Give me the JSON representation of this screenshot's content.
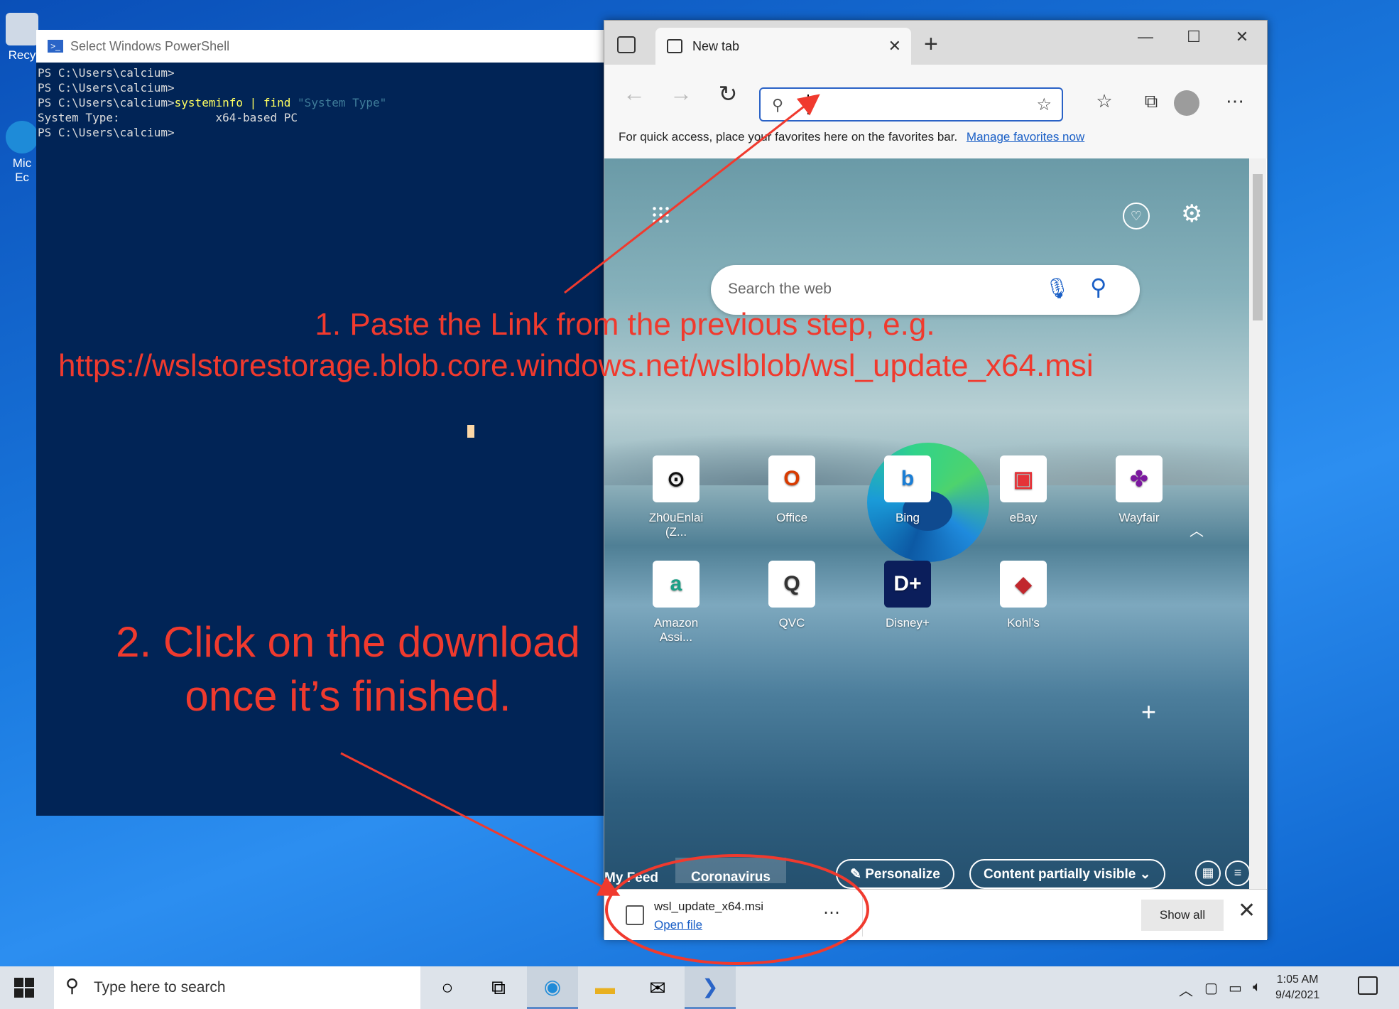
{
  "desktop": {
    "icons": [
      {
        "label": "Recy",
        "icon": "recycle-bin-icon"
      },
      {
        "label": "Mic Ec",
        "icon": "edge-shortcut-icon"
      }
    ]
  },
  "powershell": {
    "title": "Select Windows PowerShell",
    "lines": [
      {
        "prompt": "PS C:\\Users\\calcium>",
        "cmd": "",
        "arg": "",
        "str": ""
      },
      {
        "prompt": "PS C:\\Users\\calcium>",
        "cmd": "",
        "arg": "",
        "str": ""
      },
      {
        "prompt": "PS C:\\Users\\calcium>",
        "cmd": "systeminfo",
        "arg": " | find ",
        "str": "\"System Type\""
      },
      {
        "prompt": "System Type:              x64-based PC",
        "cmd": "",
        "arg": "",
        "str": ""
      },
      {
        "prompt": "PS C:\\Users\\calcium>",
        "cmd": "",
        "arg": "",
        "str": ""
      }
    ]
  },
  "edge": {
    "tab_title": "New tab",
    "favbar_text": "For quick access, place your favorites here on the favorites bar.",
    "favbar_link": "Manage favorites now",
    "ntp_search_placeholder": "Search the web",
    "tiles": [
      {
        "label": "Zh0uEnlai (Z...",
        "icon": "github-icon",
        "glyph": "⊙",
        "color": "#111"
      },
      {
        "label": "Office",
        "icon": "office-icon",
        "glyph": "O",
        "color": "#d83b01"
      },
      {
        "label": "Bing",
        "icon": "bing-icon",
        "glyph": "b",
        "color": "#1a7ed6"
      },
      {
        "label": "eBay",
        "icon": "ebay-icon",
        "glyph": "▣",
        "color": "#e53238"
      },
      {
        "label": "Wayfair",
        "icon": "wayfair-icon",
        "glyph": "✤",
        "color": "#7b189f"
      },
      {
        "label": "Amazon Assi...",
        "icon": "amazon-icon",
        "glyph": "a",
        "color": "#1aa086"
      },
      {
        "label": "QVC",
        "icon": "qvc-icon",
        "glyph": "Q",
        "color": "#333"
      },
      {
        "label": "Disney+",
        "icon": "disney-icon",
        "glyph": "D+",
        "color": "#fff"
      },
      {
        "label": "Kohl's",
        "icon": "kohls-icon",
        "glyph": "◆",
        "color": "#c1272d"
      }
    ],
    "feed_tabs": [
      "My Feed",
      "Coronavirus"
    ],
    "personalize": "Personalize",
    "content_visibility": "Content partially visible",
    "download": {
      "file": "wsl_update_x64.msi",
      "action": "Open file",
      "show_all": "Show all"
    }
  },
  "taskbar": {
    "search_placeholder": "Type here to search",
    "time": "1:05 AM",
    "date": "9/4/2021"
  },
  "annotations": {
    "step1_line1": "1. Paste the Link from the previous step, e.g.",
    "step1_line2": "https://wslstorestorage.blob.core.windows.net/wslblob/wsl_update_x64.msi",
    "step2_line1": "2. Click on the download",
    "step2_line2": "once it’s finished."
  },
  "colors": {
    "annotation": "#f03a2e",
    "powershell_bg": "#012456",
    "accent": "#1a5fc6"
  }
}
